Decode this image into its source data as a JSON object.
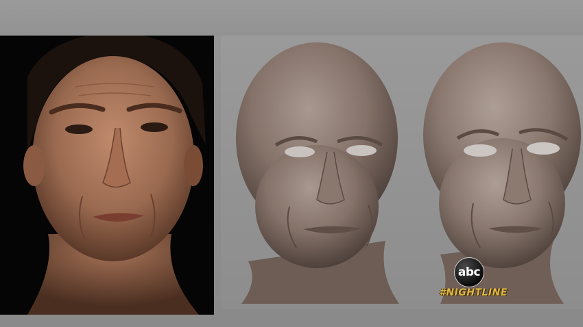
{
  "broadcast": {
    "network_logo_text": "abc",
    "program_tag": "#NIGHTLINE",
    "tag_color": "#e0b84a"
  },
  "panels": {
    "photo": {
      "background": "#050505"
    },
    "renders": {
      "count": 2,
      "material_color": "#8c7d74"
    }
  }
}
